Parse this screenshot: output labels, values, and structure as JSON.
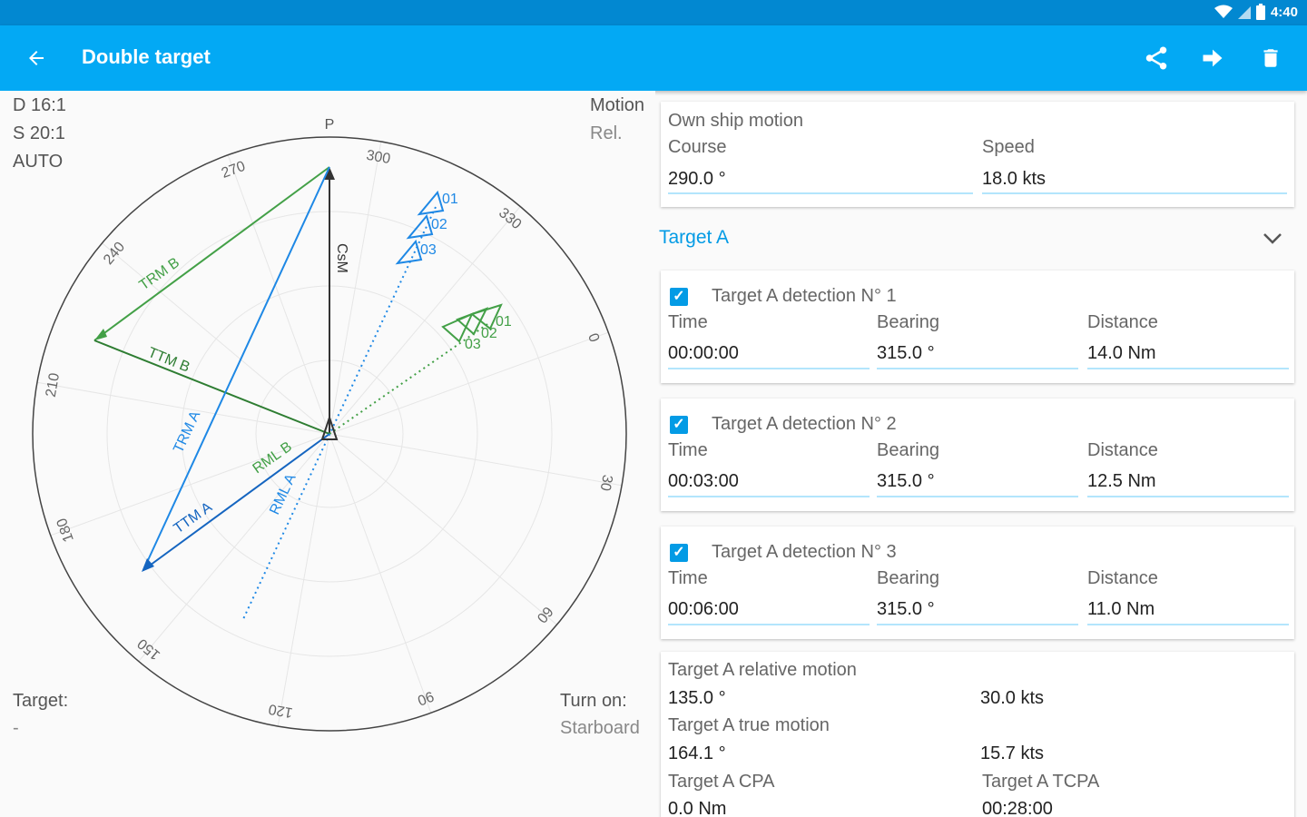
{
  "status": {
    "time": "4:40"
  },
  "app_bar": {
    "title": "Double target"
  },
  "plot": {
    "scale_d": "D 16:1",
    "scale_s": "S 20:1",
    "mode": "AUTO",
    "motion_label": "Motion",
    "motion_value": "Rel.",
    "target_label": "Target:",
    "target_value": "-",
    "turn_label": "Turn on:",
    "turn_value": "Starboard",
    "bearing_p": "P",
    "bearings": [
      "300",
      "330",
      "0",
      "30",
      "60",
      "90",
      "120",
      "150",
      "180",
      "210",
      "240",
      "270"
    ],
    "vector_labels": {
      "csm": "CsM",
      "trm_b": "TRM B",
      "ttm_b": "TTM B",
      "trm_a": "TRM A",
      "ttm_a": "TTM A",
      "rml_b": "RML B",
      "rml_a": "RML A"
    },
    "detections_a": [
      "01",
      "02",
      "03"
    ],
    "detections_b": [
      "01",
      "02",
      "03"
    ],
    "colors": {
      "a": "#1565c0",
      "b": "#43a047",
      "own": "#333333"
    }
  },
  "own_ship": {
    "title": "Own ship motion",
    "course_label": "Course",
    "course_value": "290.0 °",
    "speed_label": "Speed",
    "speed_value": "18.0 kts"
  },
  "target_a": {
    "title": "Target A",
    "detections": [
      {
        "title": "Target A detection N° 1",
        "time_label": "Time",
        "time": "00:00:00",
        "bearing_label": "Bearing",
        "bearing": "315.0 °",
        "distance_label": "Distance",
        "distance": "14.0 Nm"
      },
      {
        "title": "Target A detection N° 2",
        "time_label": "Time",
        "time": "00:03:00",
        "bearing_label": "Bearing",
        "bearing": "315.0 °",
        "distance_label": "Distance",
        "distance": "12.5 Nm"
      },
      {
        "title": "Target A detection N° 3",
        "time_label": "Time",
        "time": "00:06:00",
        "bearing_label": "Bearing",
        "bearing": "315.0 °",
        "distance_label": "Distance",
        "distance": "11.0 Nm"
      }
    ],
    "results": {
      "rel_title": "Target A relative motion",
      "rel_course": "135.0 °",
      "rel_speed": "30.0 kts",
      "true_title": "Target A true motion",
      "true_course": "164.1 °",
      "true_speed": "15.7 kts",
      "cpa_title": "Target A CPA",
      "cpa_value": "0.0 Nm",
      "tcpa_title": "Target A TCPA",
      "tcpa_value": "00:28:00"
    }
  }
}
